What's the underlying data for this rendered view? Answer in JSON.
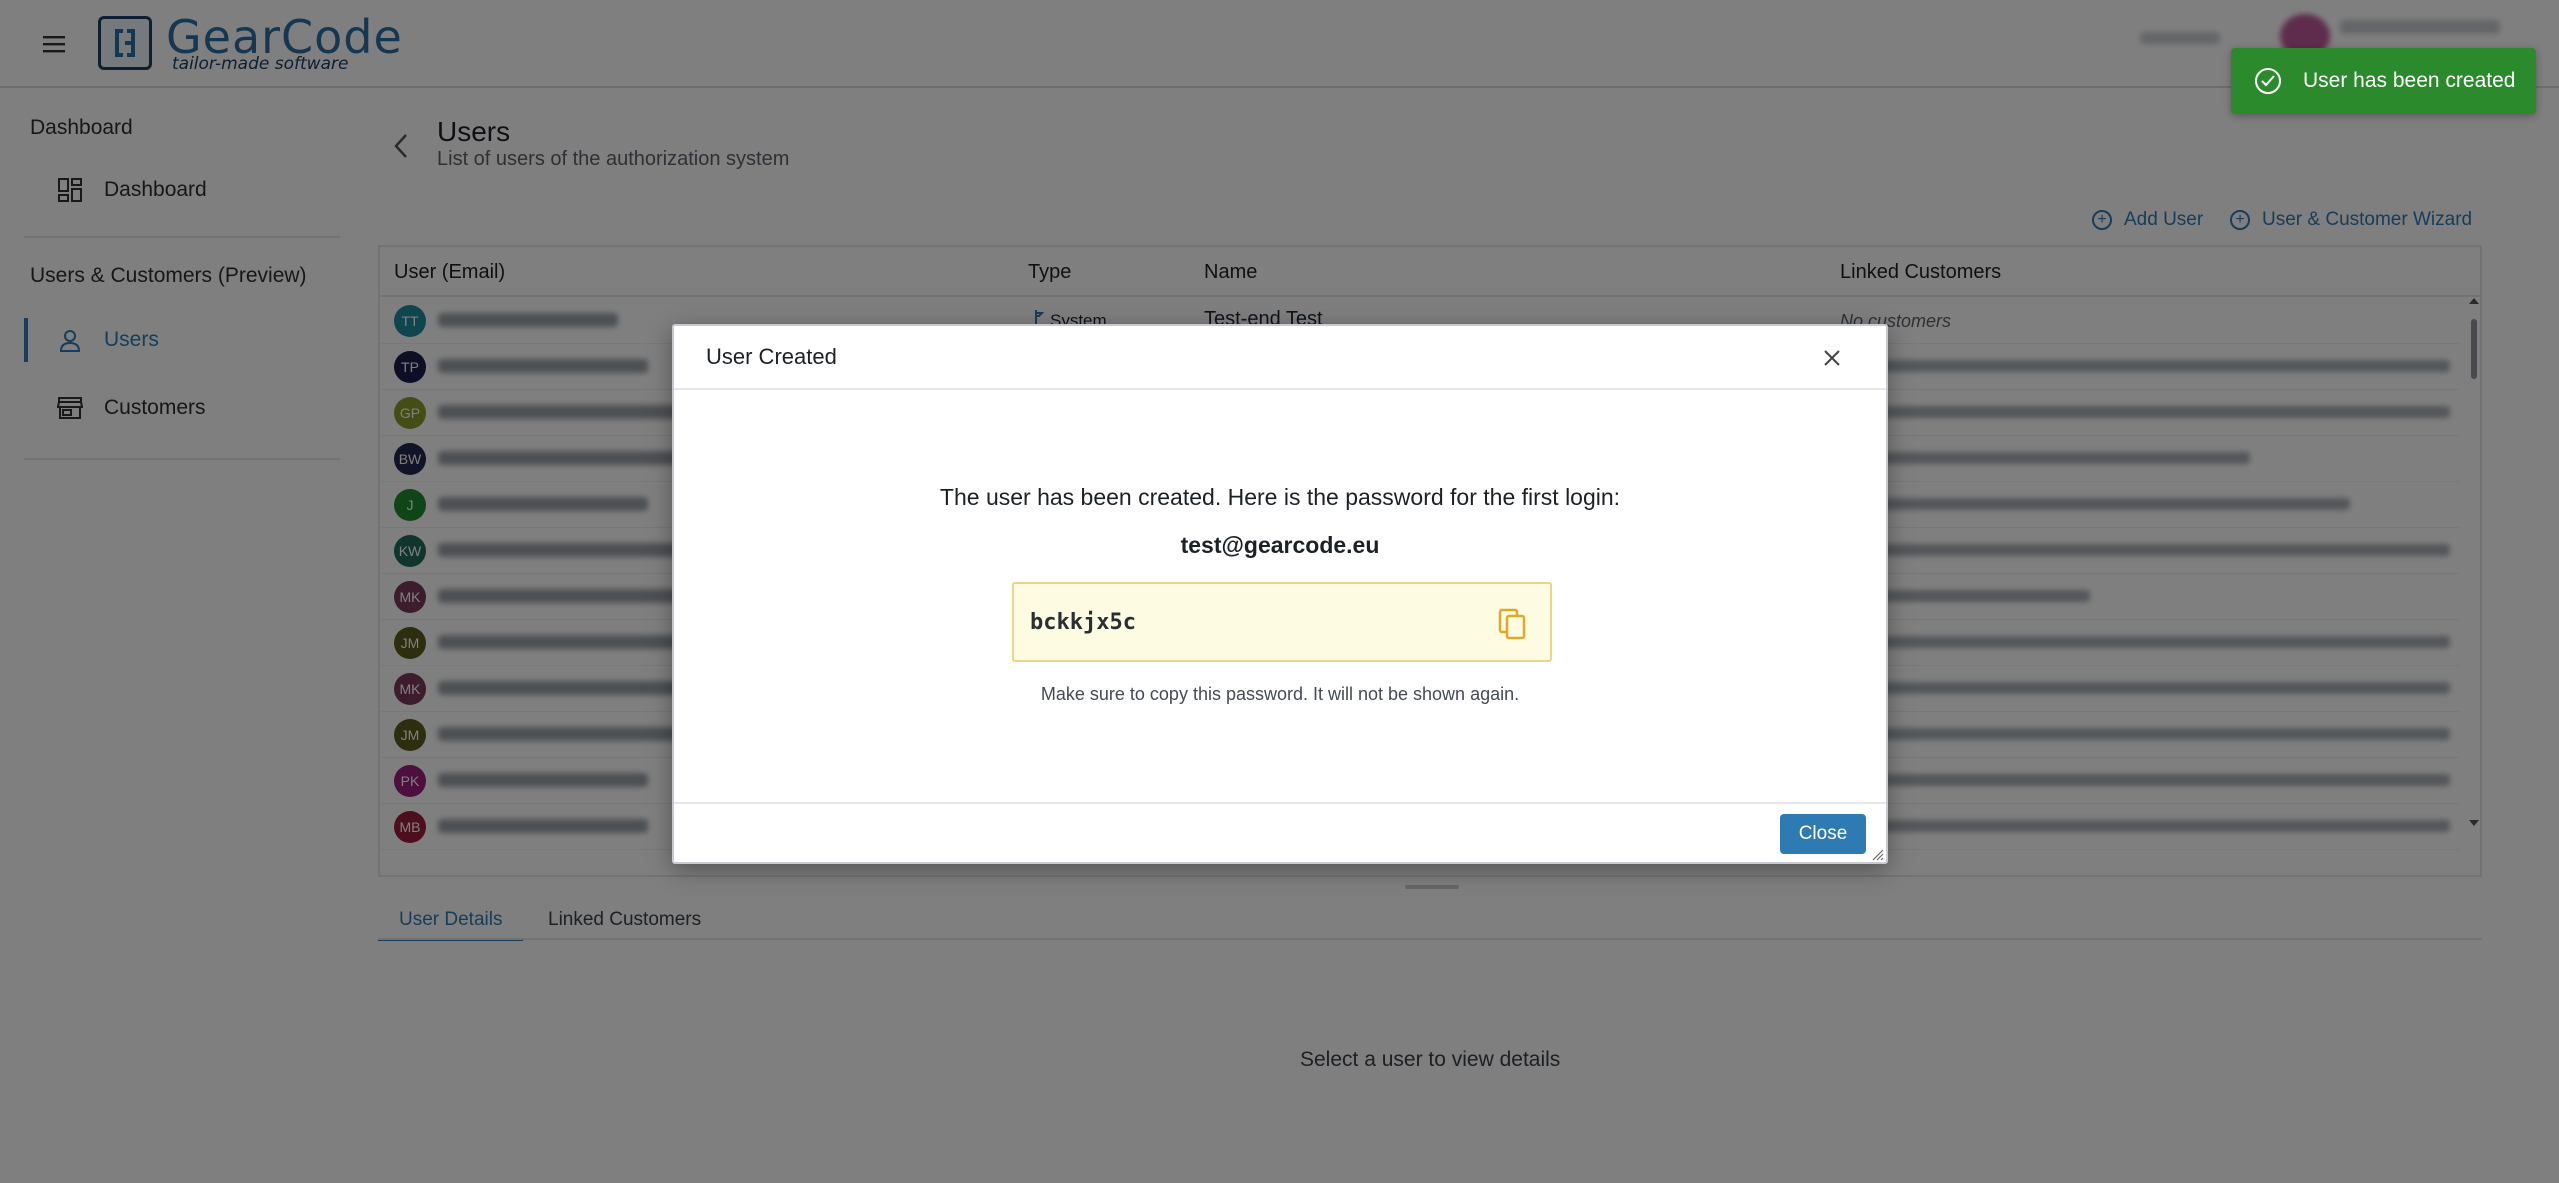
{
  "header": {
    "logo_name": "GearCode",
    "logo_tagline": "tailor-made software"
  },
  "sidebar": {
    "sections": [
      {
        "title": "Dashboard",
        "items": [
          {
            "label": "Dashboard",
            "icon": "dashboard-icon"
          }
        ]
      },
      {
        "title": "Users & Customers (Preview)",
        "items": [
          {
            "label": "Users",
            "icon": "user-icon",
            "active": true
          },
          {
            "label": "Customers",
            "icon": "store-icon"
          }
        ]
      }
    ]
  },
  "page": {
    "title": "Users",
    "subtitle": "List of users of the authorization system"
  },
  "toolbar": {
    "add_user_label": "Add User",
    "wizard_label": "User & Customer Wizard"
  },
  "table": {
    "columns": [
      "User (Email)",
      "Type",
      "Name",
      "Linked Customers"
    ],
    "first_row": {
      "type": "System",
      "name": "Test-end Test",
      "linked": "No customers"
    },
    "rows": [
      {
        "initials": "TT",
        "color": "#1e8a9e"
      },
      {
        "initials": "TP",
        "color": "#1c1f4a"
      },
      {
        "initials": "GP",
        "color": "#8a9a2e"
      },
      {
        "initials": "BW",
        "color": "#22264f"
      },
      {
        "initials": "J",
        "color": "#1e8a2e"
      },
      {
        "initials": "KW",
        "color": "#1e6a5a"
      },
      {
        "initials": "MK",
        "color": "#7a3a5a"
      },
      {
        "initials": "JM",
        "color": "#5a5a1e"
      },
      {
        "initials": "MK",
        "color": "#7a3a5a"
      },
      {
        "initials": "JM",
        "color": "#5a5a1e"
      },
      {
        "initials": "PK",
        "color": "#9a1e7a"
      },
      {
        "initials": "MB",
        "color": "#9a1e3a"
      }
    ]
  },
  "details": {
    "tabs": [
      "User Details",
      "Linked Customers"
    ],
    "empty_message": "Select a user to view details"
  },
  "toast": {
    "message": "User has been created",
    "color": "#2b8a2b"
  },
  "dialog": {
    "title": "User Created",
    "message": "The user has been created. Here is the password for the first login:",
    "email": "test@gearcode.eu",
    "password": "bckkjx5c",
    "note": "Make sure to copy this password. It will not be shown again.",
    "close_label": "Close"
  },
  "colors": {
    "accent": "#2e7bb4",
    "success": "#2b8a2b",
    "password_bg": "#fdfbe1"
  }
}
